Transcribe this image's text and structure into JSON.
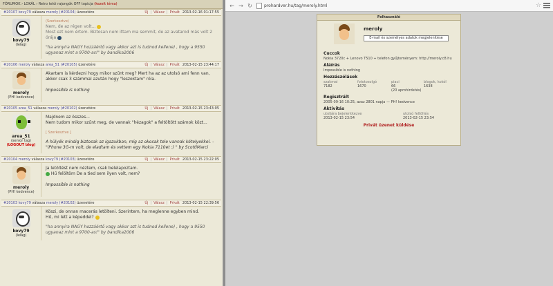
{
  "breadcrumb": {
    "forums": "FÓRUMOK",
    "sep": "LOKÁL",
    "topic": "Retro telói rajongók OFF topicja",
    "newest": "(kezelt téma)"
  },
  "actions": {
    "new": "Új",
    "reply": "Válasz",
    "private": "Privát"
  },
  "posts": [
    {
      "num": "#20107",
      "user": "kovy79",
      "verb": "válasza",
      "ruser": "meroly",
      "rnum": "(#20104)",
      "suffix": "üzenetére",
      "date": "2013-02-16 01:17:55",
      "name": "kovy79",
      "rank": "(lelag)",
      "lines": [
        "(Szerkesztve)",
        "Nem, de az régen volt...",
        "Most ezt nem értem. Biztosan nem ittam ma semmit, de az avatarod más volt 2 órája"
      ],
      "sig": "\"ha annyira NAGY hozzáértő vagy akkor azt is tudnod kellene) , hogy a 9550 ugyanaz mint a 9700-as!\" by bandika2006"
    },
    {
      "num": "#20106",
      "user": "meroly",
      "verb": "válasza",
      "ruser": "area_51",
      "rnum": "(#20105)",
      "suffix": "üzenetére",
      "date": "2013-02-15 23:44:17",
      "name": "meroly",
      "rank": "(PH! kedvence)",
      "lines": [
        "Akartam is kérdezni hogy mikor szűnt meg? Mert ha az az utolsó ami fenn van, akkor csak 3 számmal azután hogy \"leszoktam\" róla."
      ],
      "sig": "Impossible is nothing"
    },
    {
      "num": "#20105",
      "user": "area_51",
      "verb": "válasza",
      "ruser": "meroly",
      "rnum": "(#20102)",
      "suffix": "üzenetére",
      "date": "2013-02-15 23:43:05",
      "name": "area_51",
      "rank": "(senior tag)",
      "extra": "(LOGOUT blog)",
      "lines": [
        "Majdnem az összes...",
        "Nem tudom mikor szűnt meg, de vannak \"hézagok\" a feltöltött számok közt..."
      ],
      "edit": "[ Szerkesztve ]",
      "sig": "A hülyék mindig biztosak az igazukban, míg az okosak tele vannak kételyekkel. - \"iPhone 3G-m volt, de eladtam és vettem egy Nokia 7110et :) \" by ScottiMarci"
    },
    {
      "num": "#20104",
      "user": "meroly",
      "verb": "válasza",
      "ruser": "kovy79",
      "rnum": "(#20103)",
      "suffix": "üzenetére",
      "date": "2013-02-15 23:22:05",
      "name": "meroly",
      "rank": "(PH! kedvence)",
      "lines": [
        "Ja letöltést nem néztem, csak belelapoztam.",
        "Hű felöltöm  De a tied sem ilyen volt, nem?"
      ],
      "sig": "Impossible is nothing"
    },
    {
      "num": "#20103",
      "user": "kovy79",
      "verb": "válasza",
      "ruser": "meroly",
      "rnum": "(#20102)",
      "suffix": "üzenetére",
      "date": "2013-02-15 22:39:56",
      "name": "kovy79",
      "rank": "(lelag)",
      "lines": [
        "Köszi, de onnan macerás letölteni. Szerintem, ha meglenne egyben mind.",
        "Hű, mi lett a képeddel?"
      ],
      "sig": "\"ha annyira NAGY hozzáértő vagy akkor azt is tudnod kellene) , hogy a 9550 ugyanaz mint a 9700-as!\" by bandika2006"
    }
  ],
  "browser": {
    "url": "prohardver.hu/tag/meroly.html"
  },
  "profile": {
    "header": "Felhasználó",
    "name": "meroly",
    "button": "E-mail és személyes adatok megjelenítése",
    "cuccok_label": "Cuccok",
    "cuccok": "Nokia 3720c + Lenovo T510 + telefon gyűjteményem: http://meroly.c8.hu",
    "alairas_label": "Aláírás",
    "alairas": "Impossible is nothing",
    "hozza_label": "Hozzászólások",
    "stats": [
      {
        "label": "szakmai",
        "value": "7182"
      },
      {
        "label": "fototosolgó",
        "value": "1670"
      },
      {
        "label": "piaci",
        "value": "66",
        "extra": "(20 aprohirdetés)"
      },
      {
        "label": "blogok, kokól",
        "value": "1638"
      }
    ],
    "reg_label": "Regisztrált",
    "reg": "2005-09-16 10:25, azaz 2801 napja — PH! kedvence",
    "akt_label": "Aktivitás",
    "akt": [
      {
        "label": "utoljára bejelentkezve",
        "value": "2013-02-15 23:54"
      },
      {
        "label": "utolsó feltöltés",
        "value": "2013-02-15 23:54"
      }
    ],
    "message": "Privát üzenet küldése"
  }
}
